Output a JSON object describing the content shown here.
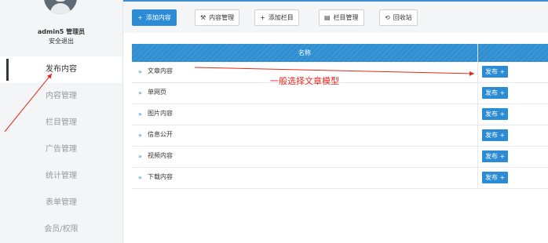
{
  "sidebar": {
    "user_name": "admin5 管理员",
    "logout_label": "安全退出",
    "items": [
      {
        "label": "发布内容",
        "active": true
      },
      {
        "label": "内容管理"
      },
      {
        "label": "栏目管理"
      },
      {
        "label": "广告管理"
      },
      {
        "label": "统计管理"
      },
      {
        "label": "表单管理"
      },
      {
        "label": "会员/权限"
      }
    ]
  },
  "toolbar": {
    "add_content": "添加内容",
    "content_manage": "内容管理",
    "add_column": "添加栏目",
    "column_manage": "栏目管理",
    "recycle_bin": "回收站"
  },
  "table": {
    "header_name": "名称",
    "add_label": "发布 +",
    "rows": [
      {
        "label": "文章内容"
      },
      {
        "label": "单网页"
      },
      {
        "label": "图片内容"
      },
      {
        "label": "信息公开"
      },
      {
        "label": "视频内容"
      },
      {
        "label": "下载内容"
      }
    ]
  },
  "annotation": {
    "text": "一般选择文章模型",
    "color": "#e8271f"
  },
  "colors": {
    "accent": "#2b8bd5",
    "header_bg": "#2f8fd0",
    "sidebar_bg": "#f4f5f6"
  }
}
